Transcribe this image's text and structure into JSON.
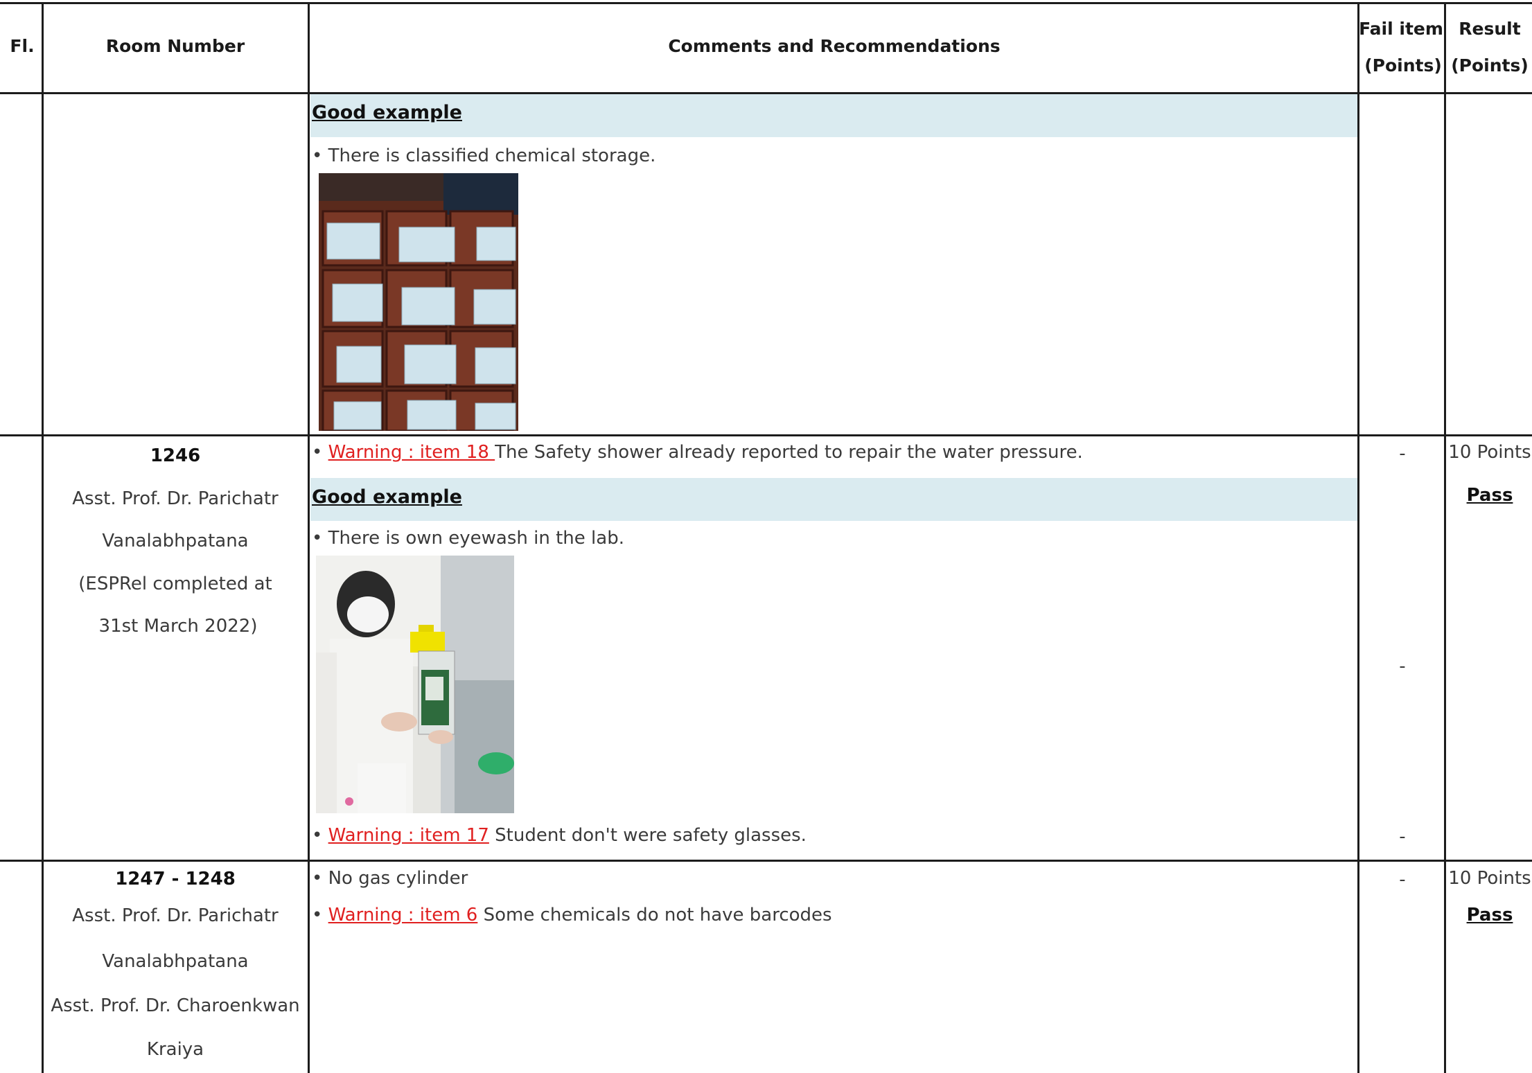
{
  "header": {
    "floor": "Fl.",
    "room": "Room Number",
    "comments": "Comments and Recommendations",
    "fail_item": [
      "Fail item",
      "(Points)"
    ],
    "result": [
      "Result",
      "(Points)"
    ]
  },
  "section1": {
    "good_example": "Good example",
    "bullet": "• There is classified chemical storage."
  },
  "section2": {
    "room_no": "1246",
    "owner": [
      "Asst. Prof. Dr. Parichatr",
      "Vanalabhpatana",
      "(ESPRel completed at",
      "31st March 2022)"
    ],
    "warning1": {
      "bullet": "• ",
      "link": "Warning : item 18 ",
      "text": " The Safety shower already reported to repair the water pressure."
    },
    "good_example": "Good example",
    "bullet": "• There is own eyewash in the lab.",
    "warning2": {
      "bullet": "• ",
      "link": "Warning : item 17",
      "text": " Student don't were safety glasses."
    },
    "fail_marks": [
      "-",
      "-",
      "-"
    ],
    "result_points": "10 Points",
    "result_status": "Pass"
  },
  "section3": {
    "room_no": "1247 - 1248",
    "owners": [
      "Asst. Prof. Dr. Parichatr",
      "Vanalabhpatana",
      "Asst. Prof. Dr. Charoenkwan",
      "Kraiya"
    ],
    "bullet1": "• No gas cylinder",
    "warning": {
      "bullet": "• ",
      "link": "Warning : item 6",
      "text": " Some chemicals do not have barcodes"
    },
    "fail_mark": "-",
    "result_points": "10 Points",
    "result_status": "Pass"
  },
  "colors": {
    "band": "#daebf0",
    "warning": "#e02020",
    "grid": "#1c1c1c"
  },
  "images": {
    "chemical_storage": "photo-chemical-storage",
    "eyewash": "photo-eyewash"
  }
}
